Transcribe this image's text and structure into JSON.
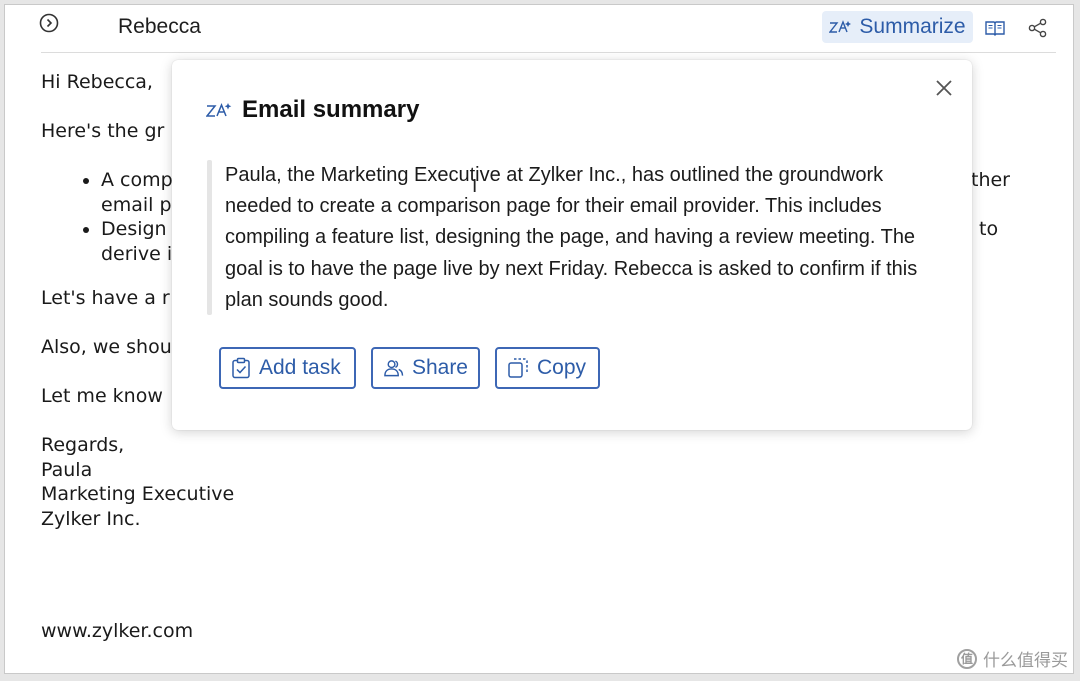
{
  "header": {
    "sender": "Rebecca",
    "summarize_label": "Summarize"
  },
  "email": {
    "greeting": "Hi Rebecca,",
    "line1": "Here's the gr",
    "bullet1_line1": "A comp",
    "bullet1_right": "ther",
    "bullet1_line2": "email p",
    "bullet2_line1": "Design",
    "bullet2_right": "to",
    "bullet2_line2": "derive i",
    "line2": "Let's have a r",
    "line3": "Also, we shou",
    "line4": "Let me know",
    "regards": "Regards,",
    "name": "Paula",
    "role": "Marketing Executive",
    "company": "Zylker Inc.",
    "website": "www.zylker.com"
  },
  "summary": {
    "title": "Email summary",
    "text": "Paula, the Marketing Executive at Zylker Inc., has outlined the groundwork needed to create a comparison page for their email provider. This includes compiling a feature list, designing the page, and having a review meeting. The goal is to have the page live by next Friday. Rebecca is asked to confirm if this plan sounds good.",
    "actions": {
      "add_task": "Add task",
      "share": "Share",
      "copy": "Copy"
    }
  },
  "watermark": {
    "text": "什么值得买",
    "badge": "值"
  },
  "colors": {
    "accent": "#2d5ca8",
    "summarize_bg": "#e6eef9",
    "quote_bar": "#e5e5e5"
  },
  "icons": {
    "expand": "expand-circle-icon",
    "summarize": "ai-sparkle-icon",
    "reader": "book-icon",
    "share_tool": "share-icon",
    "close": "close-icon",
    "add_task": "clipboard-check-icon",
    "share": "users-icon",
    "copy": "copy-icon"
  }
}
